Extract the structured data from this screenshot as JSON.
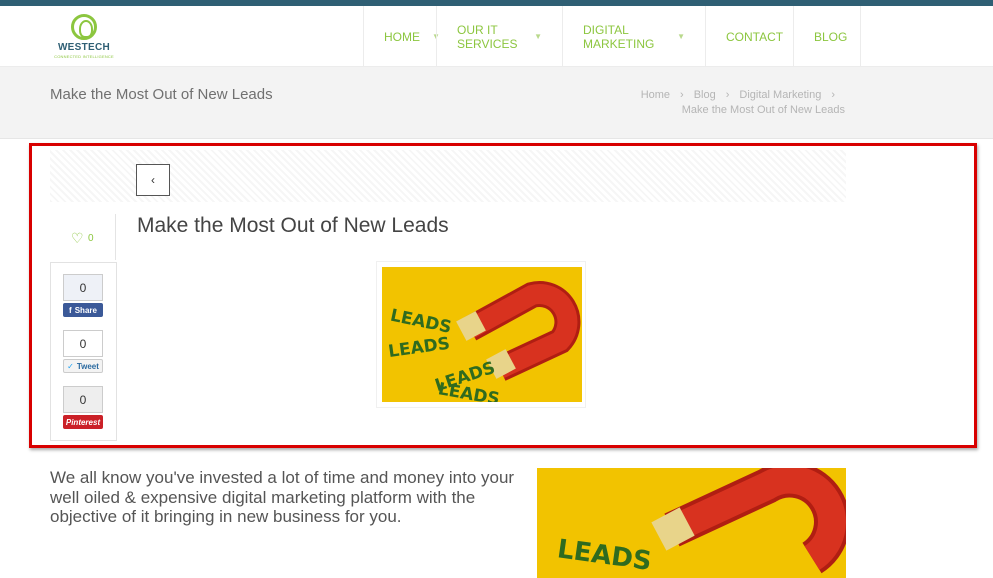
{
  "header": {
    "logo": {
      "name": "WESTECH",
      "tagline": "CONNECTED INTELLIGENCE"
    },
    "nav": [
      {
        "label": "HOME",
        "has_dropdown": true
      },
      {
        "label": "OUR IT SERVICES",
        "has_dropdown": true
      },
      {
        "label": "DIGITAL MARKETING",
        "has_dropdown": true
      },
      {
        "label": "CONTACT",
        "has_dropdown": false
      },
      {
        "label": "BLOG",
        "has_dropdown": false
      }
    ]
  },
  "title_bar": {
    "page_title": "Make the Most Out of New Leads",
    "breadcrumb": [
      "Home",
      "Blog",
      "Digital Marketing",
      "Make the Most Out of New Leads"
    ],
    "separator": "›"
  },
  "post": {
    "back_label": "‹",
    "likes": "0",
    "title": "Make the Most Out of New Leads",
    "image_icon": "magnet-leads-image",
    "share": {
      "facebook": {
        "count": "0",
        "label": "Share"
      },
      "twitter": {
        "count": "0",
        "label": "Tweet"
      },
      "pinterest": {
        "count": "0",
        "label": "Pinterest"
      }
    },
    "intro": "We all know you've invested a lot of time and money into your well oiled & expensive digital marketing platform with the objective of it bringing in new business for you."
  },
  "colors": {
    "accent": "#8cc63f",
    "topbar": "#2f5f74",
    "highlight": "#d80000",
    "image_bg": "#f2c300",
    "magnet": "#cc2a1a"
  }
}
